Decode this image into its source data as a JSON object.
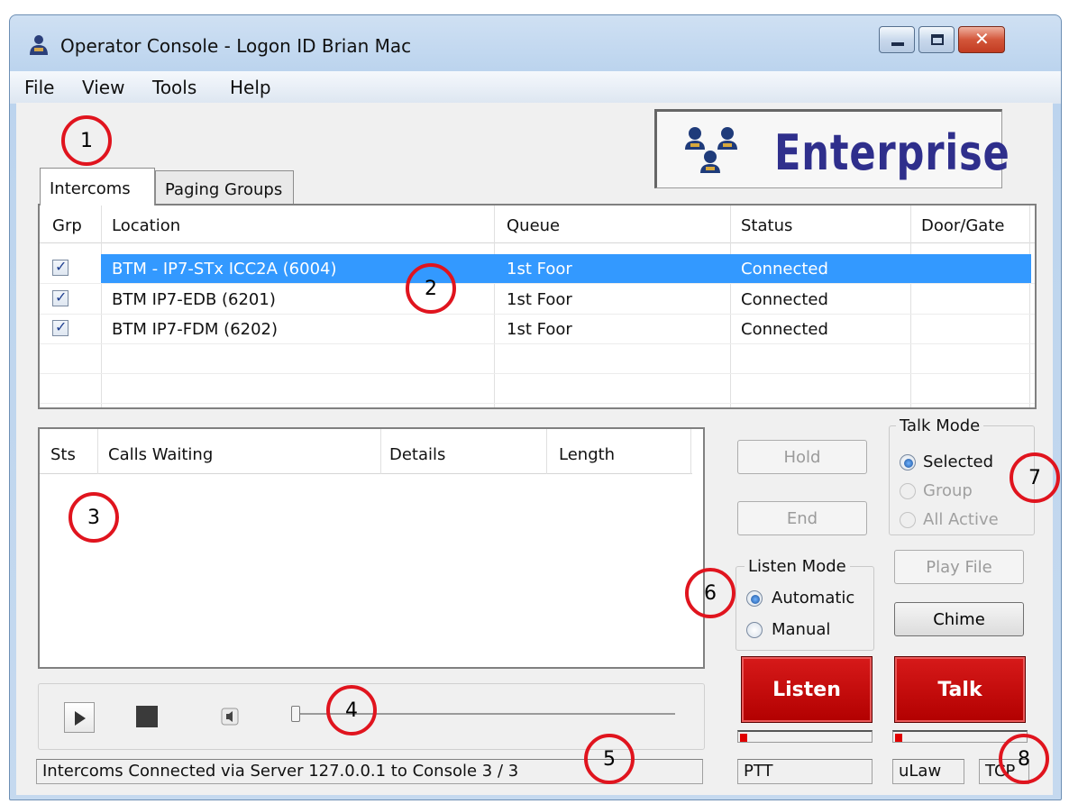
{
  "window": {
    "title": "Operator Console - Logon ID Brian Mac"
  },
  "menu": [
    "File",
    "View",
    "Tools",
    "Help"
  ],
  "logo": {
    "text": "Enterprise"
  },
  "tabs": [
    "Intercoms",
    "Paging Groups"
  ],
  "intercoms": {
    "columns": [
      "Grp",
      "Location",
      "Queue",
      "Status",
      "Door/Gate"
    ],
    "rows": [
      {
        "grp": true,
        "location": "BTM - IP7-STx ICC2A (6004)",
        "queue": "1st Foor",
        "status": "Connected",
        "door": "",
        "selected": true
      },
      {
        "grp": true,
        "location": "BTM IP7-EDB (6201)",
        "queue": "1st Foor",
        "status": "Connected",
        "door": "",
        "selected": false
      },
      {
        "grp": true,
        "location": "BTM IP7-FDM (6202)",
        "queue": "1st Foor",
        "status": "Connected",
        "door": "",
        "selected": false
      }
    ]
  },
  "calls": {
    "columns": [
      "Sts",
      "Calls Waiting",
      "Details",
      "Length"
    ]
  },
  "buttons": {
    "hold": "Hold",
    "end": "End",
    "play_file": "Play File",
    "chime": "Chime",
    "listen": "Listen",
    "talk": "Talk"
  },
  "talk_mode": {
    "title": "Talk Mode",
    "options": [
      {
        "label": "Selected",
        "selected": true,
        "enabled": true
      },
      {
        "label": "Group",
        "selected": false,
        "enabled": false
      },
      {
        "label": "All Active",
        "selected": false,
        "enabled": false
      }
    ]
  },
  "listen_mode": {
    "title": "Listen Mode",
    "options": [
      {
        "label": "Automatic",
        "selected": true
      },
      {
        "label": "Manual",
        "selected": false
      }
    ]
  },
  "player": {
    "volume": 0
  },
  "status_bar": {
    "message": "Intercoms Connected via Server 127.0.0.1 to Console 3 / 3",
    "ptt": "PTT",
    "codec": "uLaw",
    "protocol": "TCP"
  },
  "callouts": [
    "1",
    "2",
    "3",
    "4",
    "5",
    "6",
    "7",
    "8"
  ]
}
